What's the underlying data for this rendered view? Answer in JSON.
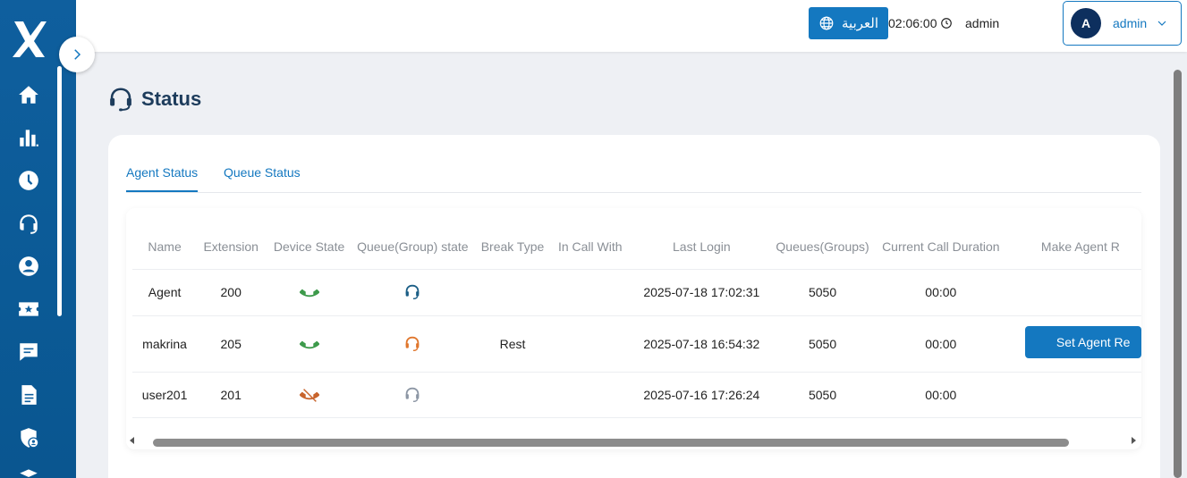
{
  "header": {
    "language_button": "العربية",
    "clock": "02:06:00",
    "user_label": "admin",
    "account": {
      "avatar_letter": "A",
      "name": "admin"
    }
  },
  "page": {
    "title": "Status"
  },
  "tabs": [
    {
      "label": "Agent Status",
      "active": true
    },
    {
      "label": "Queue Status",
      "active": false
    }
  ],
  "table": {
    "columns": [
      "Name",
      "Extension",
      "Device State",
      "Queue(Group) state",
      "Break Type",
      "In Call With",
      "Last Login",
      "Queues(Groups)",
      "Current Call Duration",
      "Make Agent R"
    ],
    "rows": [
      {
        "name": "Agent",
        "extension": "200",
        "device_state": "phone-available-icon",
        "queue_state": "headset-available-icon",
        "break_type": "",
        "in_call_with": "",
        "last_login": "2025-07-18 17:02:31",
        "queues": "5050",
        "duration": "00:00",
        "action": ""
      },
      {
        "name": "makrina",
        "extension": "205",
        "device_state": "phone-available-icon",
        "queue_state": "headset-break-icon",
        "break_type": "Rest",
        "in_call_with": "",
        "last_login": "2025-07-18 16:54:32",
        "queues": "5050",
        "duration": "00:00",
        "action": "Set Agent Re"
      },
      {
        "name": "user201",
        "extension": "201",
        "device_state": "phone-unavailable-icon",
        "queue_state": "headset-offline-icon",
        "break_type": "",
        "in_call_with": "",
        "last_login": "2025-07-16 17:26:24",
        "queues": "5050",
        "duration": "00:00",
        "action": ""
      }
    ]
  },
  "colors": {
    "sidebar": "#0f5f9e",
    "accent": "#1478c0",
    "phone_ok": "#3d9a4b",
    "phone_off": "#c8642c",
    "headset_ok": "#1b5e86",
    "headset_break": "#e0762c",
    "headset_off": "#8c96a4"
  },
  "sidebar_icons": [
    "home-icon",
    "bar-chart-icon",
    "clock-icon",
    "headset-icon",
    "user-icon",
    "ticket-star-icon",
    "chat-icon",
    "document-icon",
    "shield-user-icon",
    "stack-icon"
  ]
}
